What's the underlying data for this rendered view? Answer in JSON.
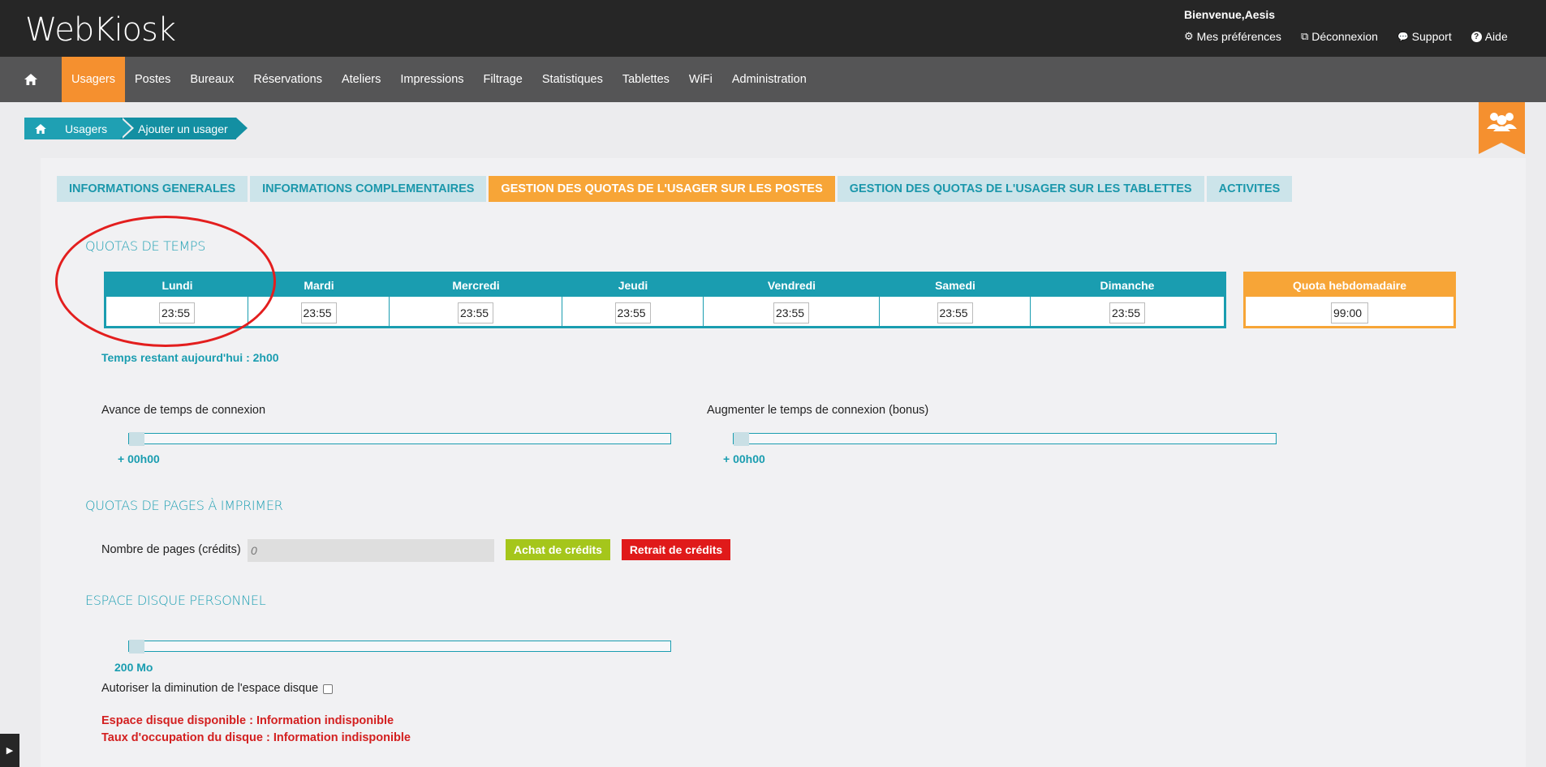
{
  "app": {
    "logo": "WebKiosk",
    "welcome": "Bienvenue,Aesis",
    "top_links": [
      {
        "icon": "gear-icon",
        "glyph": "⚙",
        "label": "Mes préférences"
      },
      {
        "icon": "external-link-icon",
        "glyph": "⧉",
        "label": "Déconnexion"
      },
      {
        "icon": "chat-icon",
        "glyph": "💬",
        "label": "Support"
      },
      {
        "icon": "help-icon",
        "glyph": "?",
        "label": "Aide"
      }
    ]
  },
  "nav": {
    "items": [
      "Usagers",
      "Postes",
      "Bureaux",
      "Réservations",
      "Ateliers",
      "Impressions",
      "Filtrage",
      "Statistiques",
      "Tablettes",
      "WiFi",
      "Administration"
    ],
    "active": "Usagers"
  },
  "breadcrumb": [
    "Usagers",
    "Ajouter un usager"
  ],
  "tabs": [
    {
      "label": "INFORMATIONS GENERALES",
      "active": false
    },
    {
      "label": "INFORMATIONS COMPLEMENTAIRES",
      "active": false
    },
    {
      "label": "GESTION DES QUOTAS DE L'USAGER SUR LES POSTES",
      "active": true
    },
    {
      "label": "GESTION DES QUOTAS DE L'USAGER SUR LES TABLETTES",
      "active": false
    },
    {
      "label": "ACTIVITES",
      "active": false
    }
  ],
  "time_quotas": {
    "title": "QUOTAS DE TEMPS",
    "days": [
      {
        "name": "Lundi",
        "value": "23:55"
      },
      {
        "name": "Mardi",
        "value": "23:55"
      },
      {
        "name": "Mercredi",
        "value": "23:55"
      },
      {
        "name": "Jeudi",
        "value": "23:55"
      },
      {
        "name": "Vendredi",
        "value": "23:55"
      },
      {
        "name": "Samedi",
        "value": "23:55"
      },
      {
        "name": "Dimanche",
        "value": "23:55"
      }
    ],
    "weekly": {
      "label": "Quota hebdomadaire",
      "value": "99:00"
    },
    "remaining": "Temps restant aujourd'hui : 2h00",
    "advance": {
      "label": "Avance de temps de connexion",
      "value": "+ 00h00",
      "level": 0
    },
    "bonus": {
      "label": "Augmenter le temps de connexion (bonus)",
      "value": "+ 00h00",
      "level": 0
    }
  },
  "print_quotas": {
    "title": "QUOTAS DE PAGES À IMPRIMER",
    "pages_label": "Nombre de pages (crédits)",
    "pages_placeholder": "0",
    "buy_label": "Achat de crédits",
    "withdraw_label": "Retrait de crédits"
  },
  "disk": {
    "title": "ESPACE DISQUE PERSONNEL",
    "value": "200 Mo",
    "level": 0,
    "allow_decrease_label": "Autoriser la diminution de l'espace disque",
    "allow_decrease_checked": false,
    "available": "Espace disque disponible : Information indisponible",
    "occupancy": "Taux d'occupation du disque : Information indisponible"
  },
  "colors": {
    "accent": "#f5902f",
    "teal": "#1a9db0",
    "buy": "#a5c61b",
    "withdraw": "#e01a1a",
    "warning": "#d32020"
  }
}
